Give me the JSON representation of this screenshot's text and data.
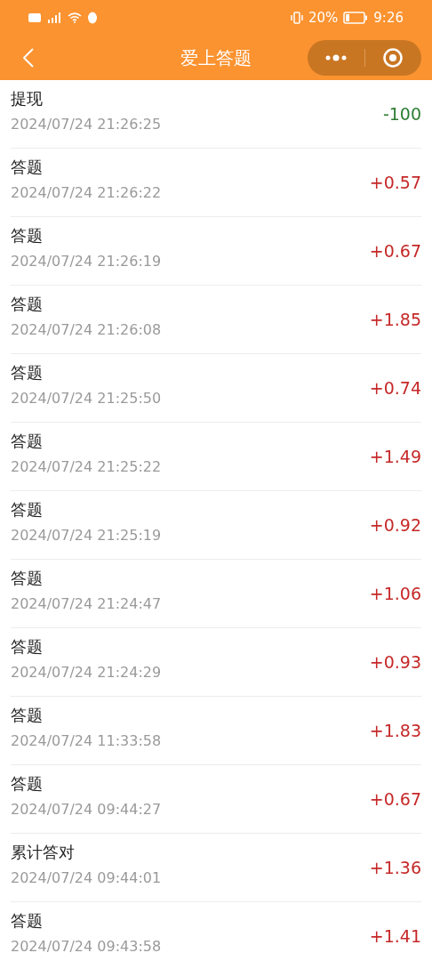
{
  "status_bar": {
    "battery_percent": "20%",
    "time": "9:26"
  },
  "nav": {
    "title": "爱上答题"
  },
  "records": [
    {
      "title": "提现",
      "time": "2024/07/24 21:26:25",
      "amount": "-100",
      "kind": "expense"
    },
    {
      "title": "答题",
      "time": "2024/07/24 21:26:22",
      "amount": "+0.57",
      "kind": "income"
    },
    {
      "title": "答题",
      "time": "2024/07/24 21:26:19",
      "amount": "+0.67",
      "kind": "income"
    },
    {
      "title": "答题",
      "time": "2024/07/24 21:26:08",
      "amount": "+1.85",
      "kind": "income"
    },
    {
      "title": "答题",
      "time": "2024/07/24 21:25:50",
      "amount": "+0.74",
      "kind": "income"
    },
    {
      "title": "答题",
      "time": "2024/07/24 21:25:22",
      "amount": "+1.49",
      "kind": "income"
    },
    {
      "title": "答题",
      "time": "2024/07/24 21:25:19",
      "amount": "+0.92",
      "kind": "income"
    },
    {
      "title": "答题",
      "time": "2024/07/24 21:24:47",
      "amount": "+1.06",
      "kind": "income"
    },
    {
      "title": "答题",
      "time": "2024/07/24 21:24:29",
      "amount": "+0.93",
      "kind": "income"
    },
    {
      "title": "答题",
      "time": "2024/07/24 11:33:58",
      "amount": "+1.83",
      "kind": "income"
    },
    {
      "title": "答题",
      "time": "2024/07/24 09:44:27",
      "amount": "+0.67",
      "kind": "income"
    },
    {
      "title": "累计答对",
      "time": "2024/07/24 09:44:01",
      "amount": "+1.36",
      "kind": "income"
    },
    {
      "title": "答题",
      "time": "2024/07/24 09:43:58",
      "amount": "+1.41",
      "kind": "income"
    }
  ]
}
